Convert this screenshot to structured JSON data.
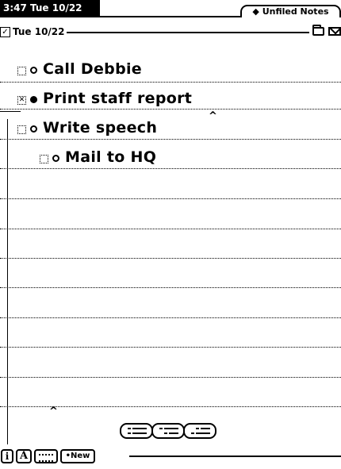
{
  "status": {
    "clock": "3:47 Tue 10/22"
  },
  "folder_tab": {
    "label": "◆ Unfiled Notes"
  },
  "note": {
    "date": "Tue 10/22",
    "date_checkbox": "✓",
    "items": [
      {
        "text": "Call Debbie",
        "checked": false,
        "bullet": "open",
        "indent": 0
      },
      {
        "text": "Print staff report",
        "checked": true,
        "bullet": "filled",
        "indent": 0
      },
      {
        "text": "Write speech",
        "checked": false,
        "bullet": "open",
        "indent": 0
      },
      {
        "text": "Mail to HQ",
        "checked": false,
        "bullet": "open",
        "indent": 1
      }
    ],
    "checked_mark": "✕",
    "caret": "^"
  },
  "toolbar": {
    "info_label": "i",
    "styles_label": "A",
    "keyboard_icon": "keyboard-icon",
    "new_label": "•New"
  }
}
